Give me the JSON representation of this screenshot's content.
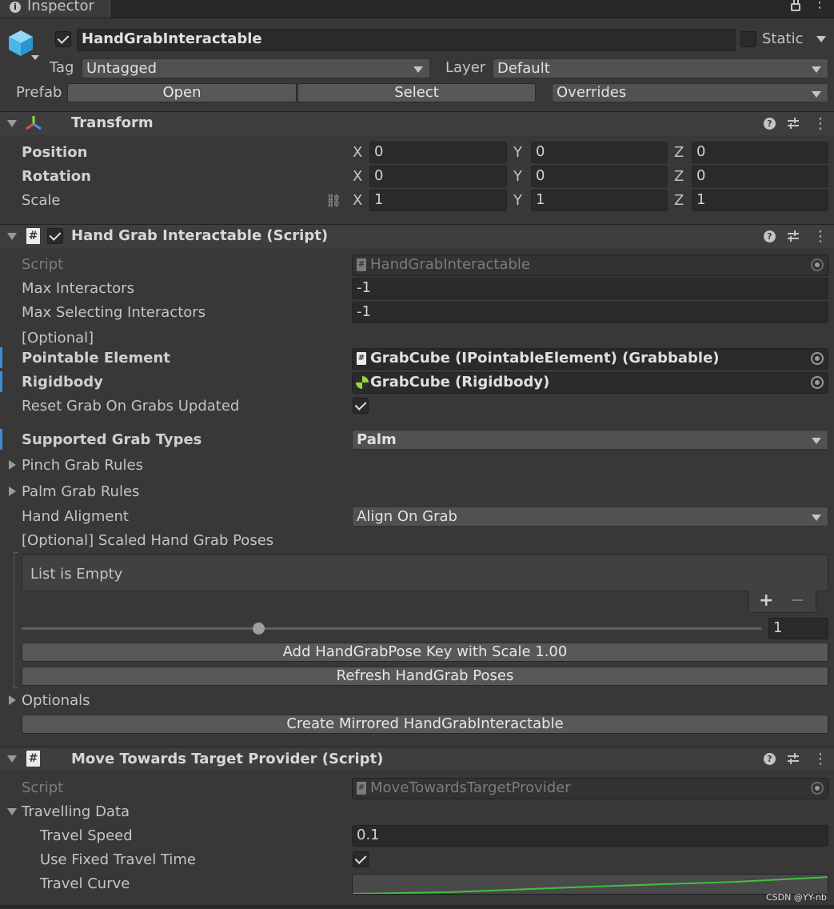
{
  "tab": {
    "title": "Inspector",
    "info_glyph": "i"
  },
  "object": {
    "name": "HandGrabInteractable",
    "static_label": "Static",
    "tag_label": "Tag",
    "tag_value": "Untagged",
    "layer_label": "Layer",
    "layer_value": "Default"
  },
  "prefab": {
    "label": "Prefab",
    "open": "Open",
    "select": "Select",
    "overrides": "Overrides"
  },
  "transform": {
    "title": "Transform",
    "position": "Position",
    "rotation": "Rotation",
    "scale": "Scale",
    "axes": {
      "x": "X",
      "y": "Y",
      "z": "Z"
    },
    "pos": [
      "0",
      "0",
      "0"
    ],
    "rot": [
      "0",
      "0",
      "0"
    ],
    "scl": [
      "1",
      "1",
      "1"
    ]
  },
  "hgi": {
    "title": "Hand Grab Interactable (Script)",
    "hash": "#",
    "script_label": "Script",
    "script_value": "HandGrabInteractable",
    "max_interactors_label": "Max Interactors",
    "max_interactors": "-1",
    "max_selecting_label": "Max Selecting Interactors",
    "max_selecting": "-1",
    "optional": "[Optional]",
    "pointable_label": "Pointable Element",
    "pointable_value": "GrabCube (IPointableElement) (Grabbable)",
    "rigidbody_label": "Rigidbody",
    "rigidbody_value": "GrabCube (Rigidbody)",
    "reset_label": "Reset Grab On Grabs Updated",
    "grab_types_label": "Supported Grab Types",
    "grab_types_value": "Palm",
    "pinch_rules": "Pinch Grab Rules",
    "palm_rules": "Palm Grab Rules",
    "hand_align_label": "Hand Aligment",
    "hand_align_value": "Align On Grab",
    "scaled_label": "[Optional] Scaled Hand Grab Poses",
    "list_empty": "List is Empty",
    "plus": "+",
    "minus": "−",
    "slider_value": "1",
    "slider_fraction": 0.32,
    "add_key_btn": "Add HandGrabPose Key with Scale 1.00",
    "refresh_btn": "Refresh HandGrab Poses",
    "optionals": "Optionals",
    "mirror_btn": "Create Mirrored HandGrabInteractable"
  },
  "mttp": {
    "title": "Move Towards Target Provider (Script)",
    "hash": "#",
    "script_label": "Script",
    "script_value": "MoveTowardsTargetProvider",
    "travelling_label": "Travelling Data",
    "speed_label": "Travel Speed",
    "speed_value": "0.1",
    "fixed_label": "Use Fixed Travel Time",
    "curve_label": "Travel Curve"
  },
  "watermark": "CSDN @YY-nb",
  "colors": {
    "curve": "#3ec13e",
    "accent_bar": "#3c8ad6"
  }
}
